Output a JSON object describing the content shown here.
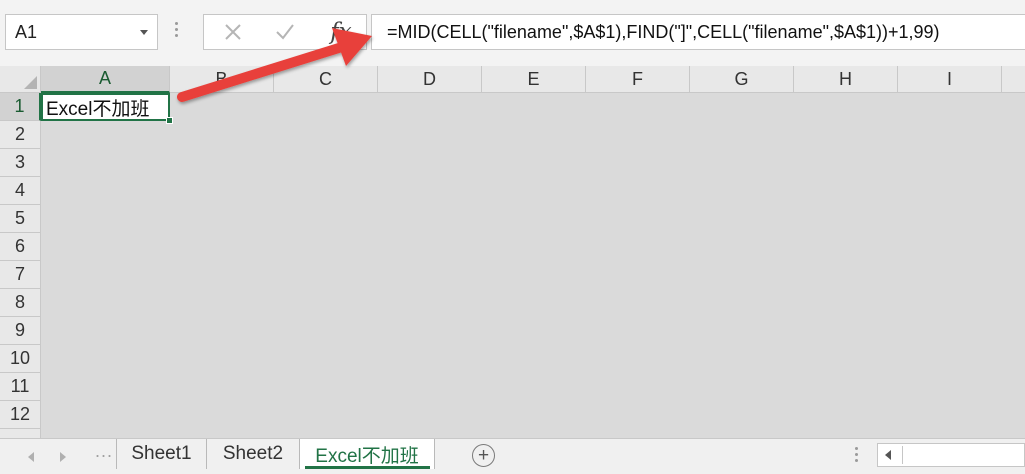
{
  "formula_bar": {
    "name_box": "A1",
    "insert_function_label": "fx",
    "formula": "=MID(CELL(\"filename\",$A$1),FIND(\"]\",CELL(\"filename\",$A$1))+1,99)"
  },
  "grid": {
    "columns": [
      "A",
      "B",
      "C",
      "D",
      "E",
      "F",
      "G",
      "H",
      "I"
    ],
    "rows": [
      "1",
      "2",
      "3",
      "4",
      "5",
      "6",
      "7",
      "8",
      "9",
      "10",
      "11",
      "12"
    ],
    "active_cell": "A1",
    "cell_a1_value": "Excel不加班"
  },
  "sheets": {
    "tabs": [
      "Sheet1",
      "Sheet2",
      "Excel不加班"
    ],
    "active": "Excel不加班",
    "add_label": "+",
    "more_label": "..."
  },
  "colors": {
    "accent": "#217346",
    "arrow": "#e8413a"
  }
}
